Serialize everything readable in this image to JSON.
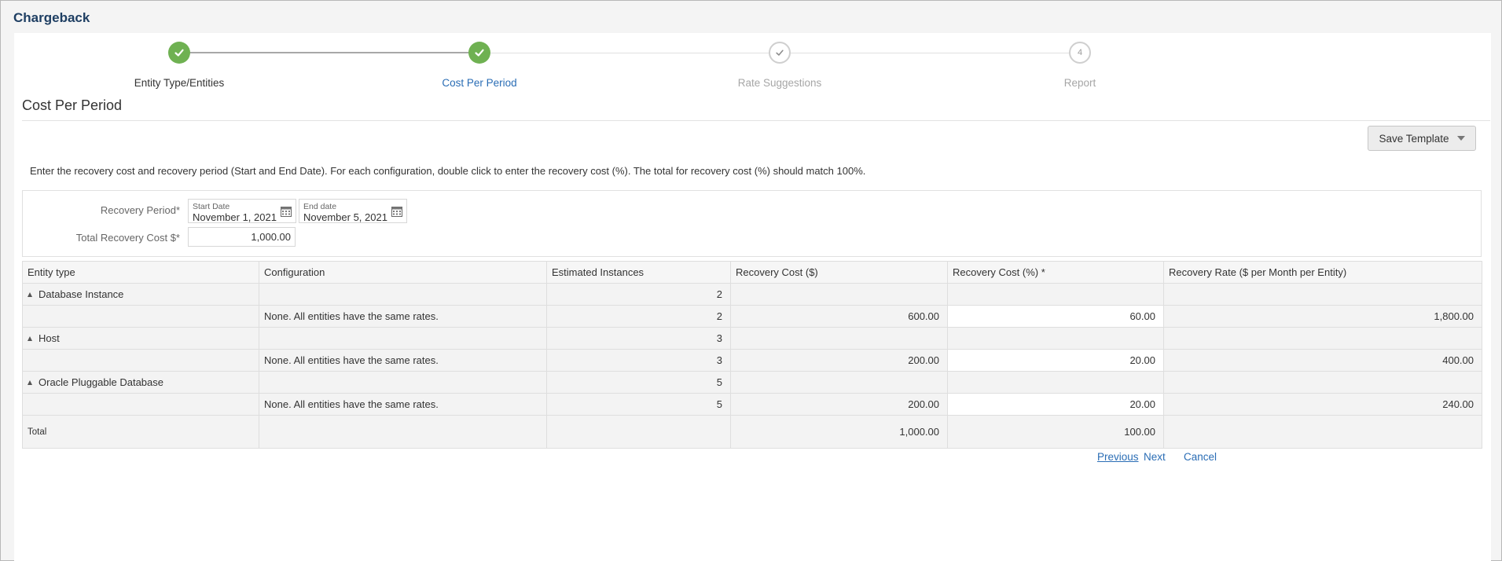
{
  "app": {
    "title": "Chargeback"
  },
  "train": {
    "steps": [
      {
        "label": "Entity Type/Entities",
        "state": "visited"
      },
      {
        "label": "Cost Per Period",
        "state": "current"
      },
      {
        "label": "Rate Suggestions",
        "state": "future"
      },
      {
        "label": "Report",
        "state": "future",
        "number": "4"
      }
    ]
  },
  "section": {
    "title": "Cost Per Period"
  },
  "toolbar": {
    "save_template_label": "Save Template"
  },
  "instructions": "Enter the recovery cost and recovery period (Start and End Date). For each configuration, double click to enter the recovery cost (%). The total for recovery cost (%) should match 100%.",
  "form": {
    "recovery_period_label": "Recovery Period*",
    "start_date_label": "Start Date",
    "start_date_value": "November 1, 2021",
    "end_date_label": "End date",
    "end_date_value": "November 5, 2021",
    "total_cost_label": "Total Recovery Cost $*",
    "total_cost_value": "1,000.00"
  },
  "table": {
    "columns": [
      "Entity type",
      "Configuration",
      "Estimated Instances",
      "Recovery Cost ($)",
      "Recovery Cost (%) *",
      "Recovery Rate ($ per Month per Entity)"
    ],
    "rows": [
      {
        "entity": "Database Instance",
        "config": "",
        "instances": "2",
        "cost": "",
        "percent": "",
        "rate": ""
      },
      {
        "entity": "",
        "config": "None. All entities have the same rates.",
        "instances": "2",
        "cost": "600.00",
        "percent": "60.00",
        "rate": "1,800.00"
      },
      {
        "entity": "Host",
        "config": "",
        "instances": "3",
        "cost": "",
        "percent": "",
        "rate": ""
      },
      {
        "entity": "",
        "config": "None. All entities have the same rates.",
        "instances": "3",
        "cost": "200.00",
        "percent": "20.00",
        "rate": "400.00"
      },
      {
        "entity": "Oracle Pluggable Database",
        "config": "",
        "instances": "5",
        "cost": "",
        "percent": "",
        "rate": ""
      },
      {
        "entity": "",
        "config": "None. All entities have the same rates.",
        "instances": "5",
        "cost": "200.00",
        "percent": "20.00",
        "rate": "240.00"
      }
    ],
    "total": {
      "label": "Total",
      "cost": "1,000.00",
      "percent": "100.00"
    }
  },
  "footer": {
    "previous_label": "Previous",
    "next_label": "Next",
    "cancel_label": "Cancel"
  },
  "colors": {
    "accent": "#2a6db5",
    "step_done": "#6fb152",
    "title": "#1f3f63"
  },
  "icons": {
    "step_done": "check-icon",
    "date": "calendar-icon",
    "expand": "triangle-down-icon",
    "menu": "caret-down-icon"
  }
}
